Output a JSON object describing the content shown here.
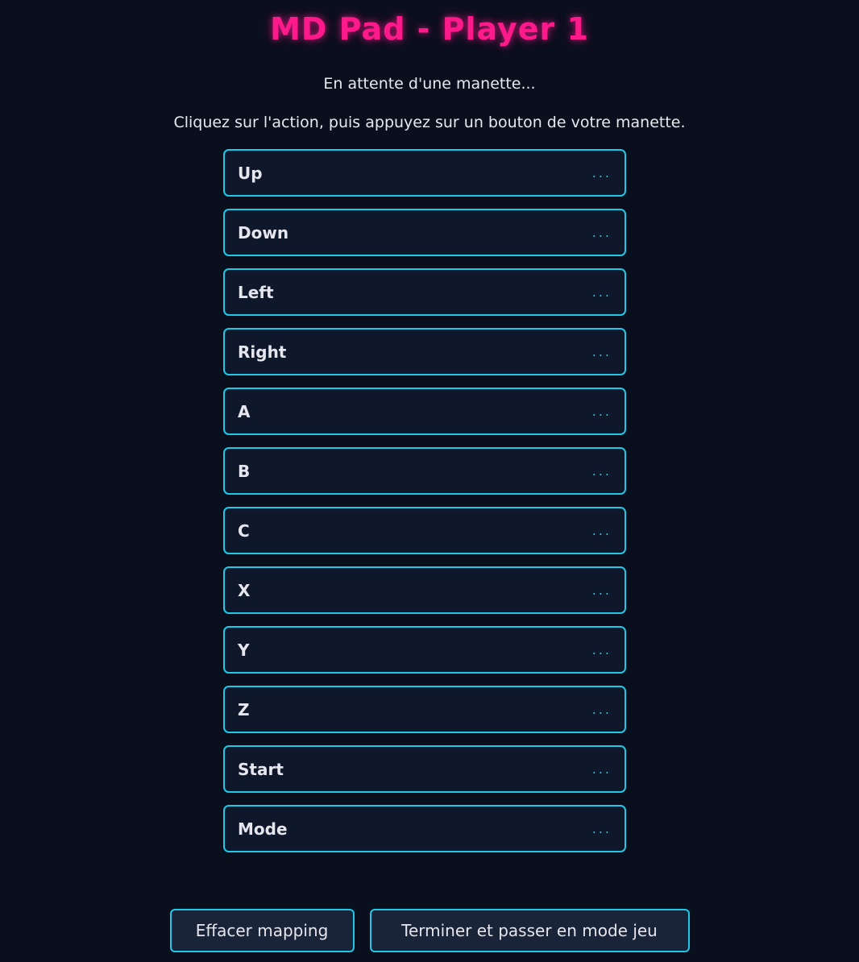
{
  "header": {
    "title": "MD Pad - Player 1",
    "status": "En attente d'une manette...",
    "instructions": "Cliquez sur l'action, puis appuyez sur un bouton de votre manette."
  },
  "mapping": [
    {
      "label": "Up",
      "value": "..."
    },
    {
      "label": "Down",
      "value": "..."
    },
    {
      "label": "Left",
      "value": "..."
    },
    {
      "label": "Right",
      "value": "..."
    },
    {
      "label": "A",
      "value": "..."
    },
    {
      "label": "B",
      "value": "..."
    },
    {
      "label": "C",
      "value": "..."
    },
    {
      "label": "X",
      "value": "..."
    },
    {
      "label": "Y",
      "value": "..."
    },
    {
      "label": "Z",
      "value": "..."
    },
    {
      "label": "Start",
      "value": "..."
    },
    {
      "label": "Mode",
      "value": "..."
    }
  ],
  "actions": {
    "clear_label": "Effacer mapping",
    "finish_label": "Terminer et passer en mode jeu"
  },
  "colors": {
    "background": "#0a0f1e",
    "title": "#ff1a8c",
    "accent": "#1ec8e6",
    "row_background": "#0f172a",
    "button_background": "#1a2438"
  }
}
